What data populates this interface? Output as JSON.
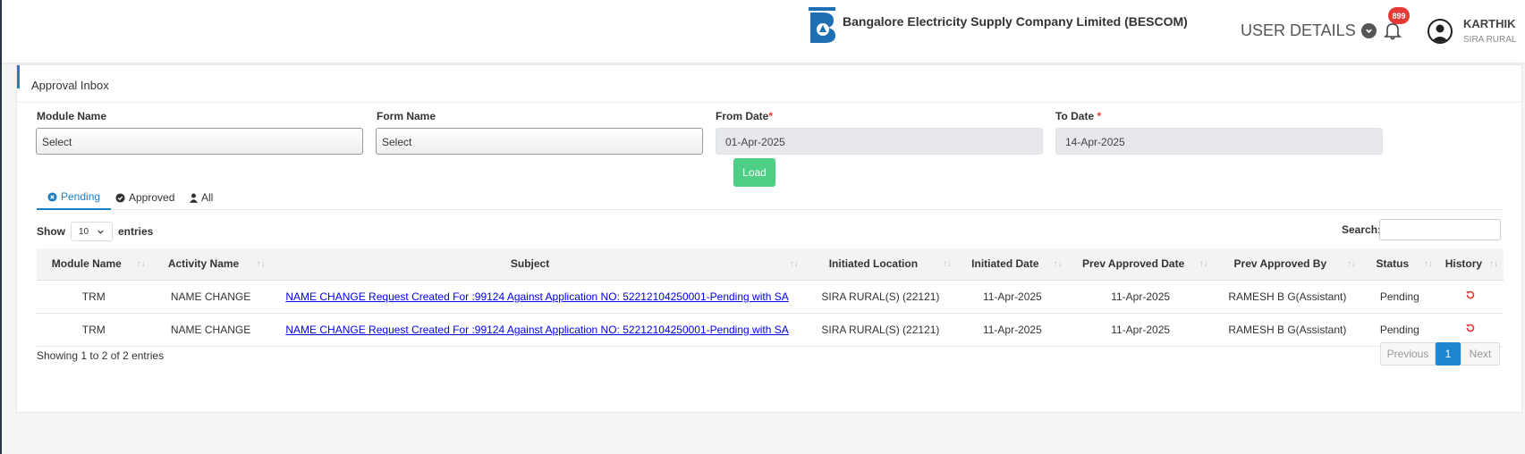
{
  "header": {
    "logo_text": "BESCOM",
    "company": "Bangalore Electricity Supply Company Limited (BESCOM)",
    "user_details_label": "USER DETAILS",
    "notification_count": "899",
    "user_name": "KARTHIK",
    "user_location": "SIRA RURAL"
  },
  "page": {
    "title": "Approval Inbox"
  },
  "filters": {
    "module_label": "Module Name",
    "module_value": "Select",
    "form_label": "Form Name",
    "form_value": "Select",
    "from_label": "From Date",
    "from_value": "01-Apr-2025",
    "to_label": "To Date",
    "to_value": "14-Apr-2025",
    "required_mark": "*",
    "load_label": "Load"
  },
  "tabs": [
    {
      "label": "Pending",
      "icon": "times-circle-icon"
    },
    {
      "label": "Approved",
      "icon": "check-circle-icon"
    },
    {
      "label": "All",
      "icon": "user-icon"
    }
  ],
  "table_controls": {
    "show_label": "Show",
    "entries_value": "10",
    "entries_label": "entries",
    "search_label": "Search:"
  },
  "table": {
    "columns": [
      "Module Name",
      "Activity Name",
      "Subject",
      "Initiated Location",
      "Initiated Date",
      "Prev Approved Date",
      "Prev Approved By",
      "Status",
      "History"
    ],
    "rows": [
      [
        "TRM",
        "NAME CHANGE",
        "NAME CHANGE Request Created For :99124 Against Application NO: 52212104250001-Pending with SA",
        "SIRA RURAL(S) (22121)",
        "11-Apr-2025",
        "11-Apr-2025",
        "RAMESH B G(Assistant)",
        "Pending"
      ],
      [
        "TRM",
        "NAME CHANGE",
        "NAME CHANGE Request Created For :99124 Against Application NO: 52212104250001-Pending with SA",
        "SIRA RURAL(S) (22121)",
        "11-Apr-2025",
        "11-Apr-2025",
        "RAMESH B G(Assistant)",
        "Pending"
      ]
    ]
  },
  "footer": {
    "info": "Showing 1 to 2 of 2 entries",
    "prev_label": "Previous",
    "page_label": "1",
    "next_label": "Next"
  },
  "colors": {
    "accent": "#1f7fc4",
    "load_button": "#4fce86",
    "badge": "#e53935",
    "history_icon": "#e53935"
  }
}
